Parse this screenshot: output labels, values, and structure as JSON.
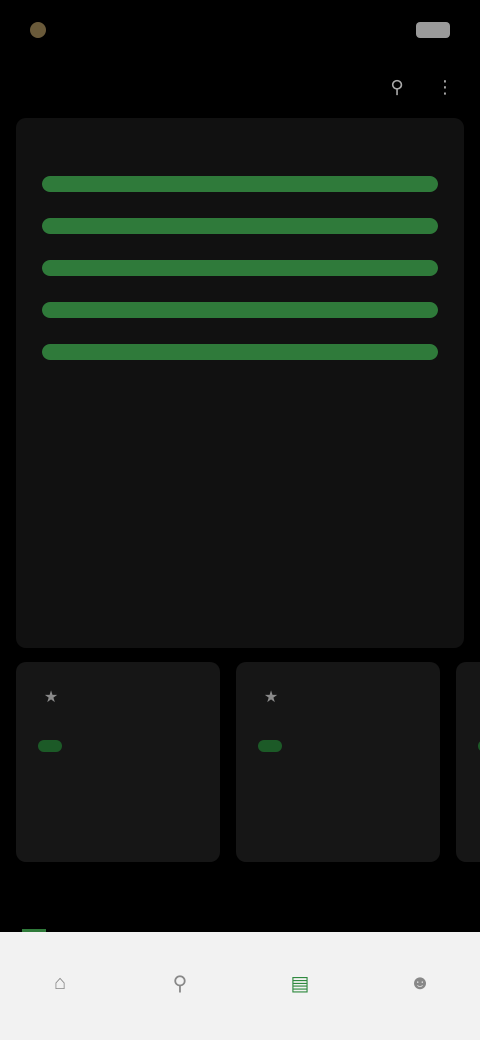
{
  "status_bar": {
    "time": "",
    "carrier": "",
    "signal": ""
  },
  "header": {
    "title": "",
    "action_icons": [
      "search-icon",
      "more-icon"
    ]
  },
  "stats_card": {
    "title": "",
    "description": "",
    "rows": [
      {
        "label": "",
        "fill": 1.0
      },
      {
        "label": "",
        "fill": 1.0
      },
      {
        "label": "",
        "fill": 1.0
      },
      {
        "label": "",
        "fill": 1.0
      },
      {
        "label": "",
        "fill": 1.0
      }
    ]
  },
  "tiles": [
    {
      "icon": "trophy-icon",
      "value": "",
      "label": ""
    },
    {
      "icon": "trophy-icon",
      "value": "",
      "label": ""
    },
    {
      "icon": "trophy-icon",
      "value": "",
      "label": ""
    }
  ],
  "chips": [
    {
      "label": ""
    },
    {
      "label": ""
    },
    {
      "label": ""
    },
    {
      "label": ""
    }
  ],
  "bottom_nav": [
    {
      "icon": "home-icon",
      "label": ""
    },
    {
      "icon": "search-icon",
      "label": ""
    },
    {
      "icon": "stats-icon",
      "label": "",
      "active": true
    },
    {
      "icon": "profile-icon",
      "label": ""
    }
  ],
  "colors": {
    "accent": "#2f7a3a",
    "accent_text": "#5fd06d",
    "background": "#000000",
    "card": "#111111",
    "nav_bg": "#f2f2f2"
  }
}
